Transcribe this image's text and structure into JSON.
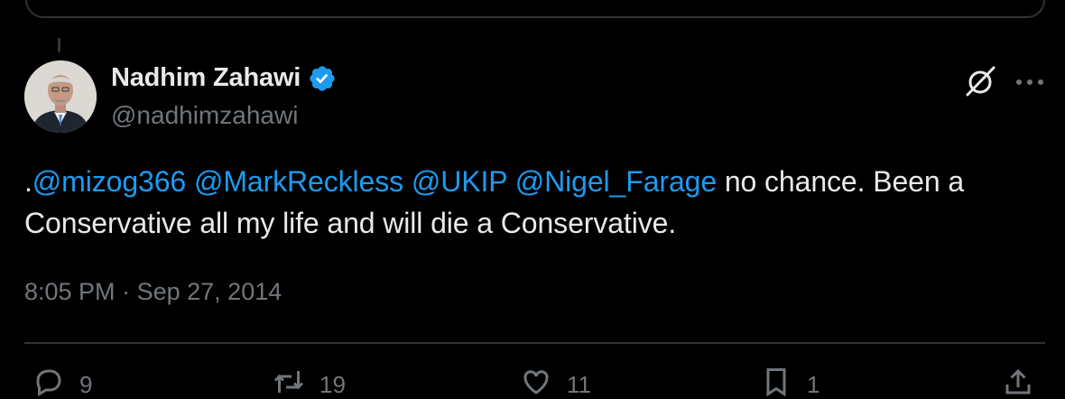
{
  "author": {
    "display_name": "Nadhim Zahawi",
    "handle": "@nadhimzahawi",
    "verified": true
  },
  "tweet": {
    "lead": ".",
    "mentions": [
      "@mizog366",
      "@MarkReckless",
      "@UKIP",
      "@Nigel_Farage"
    ],
    "body": "no chance. Been a Conservative all my life and will die a Conservative."
  },
  "meta": {
    "time": "8:05 PM",
    "separator": "·",
    "date": "Sep 27, 2014"
  },
  "actions": {
    "reply_count": "9",
    "retweet_count": "19",
    "like_count": "11",
    "bookmark_count": "1"
  },
  "colors": {
    "background": "#000000",
    "text": "#e7e9ea",
    "secondary": "#71767b",
    "link": "#1d9bf0",
    "border": "#2f3336"
  },
  "icons": [
    "grok-icon",
    "more-icon",
    "verified-badge-icon",
    "reply-icon",
    "retweet-icon",
    "like-icon",
    "bookmark-icon",
    "share-icon"
  ]
}
